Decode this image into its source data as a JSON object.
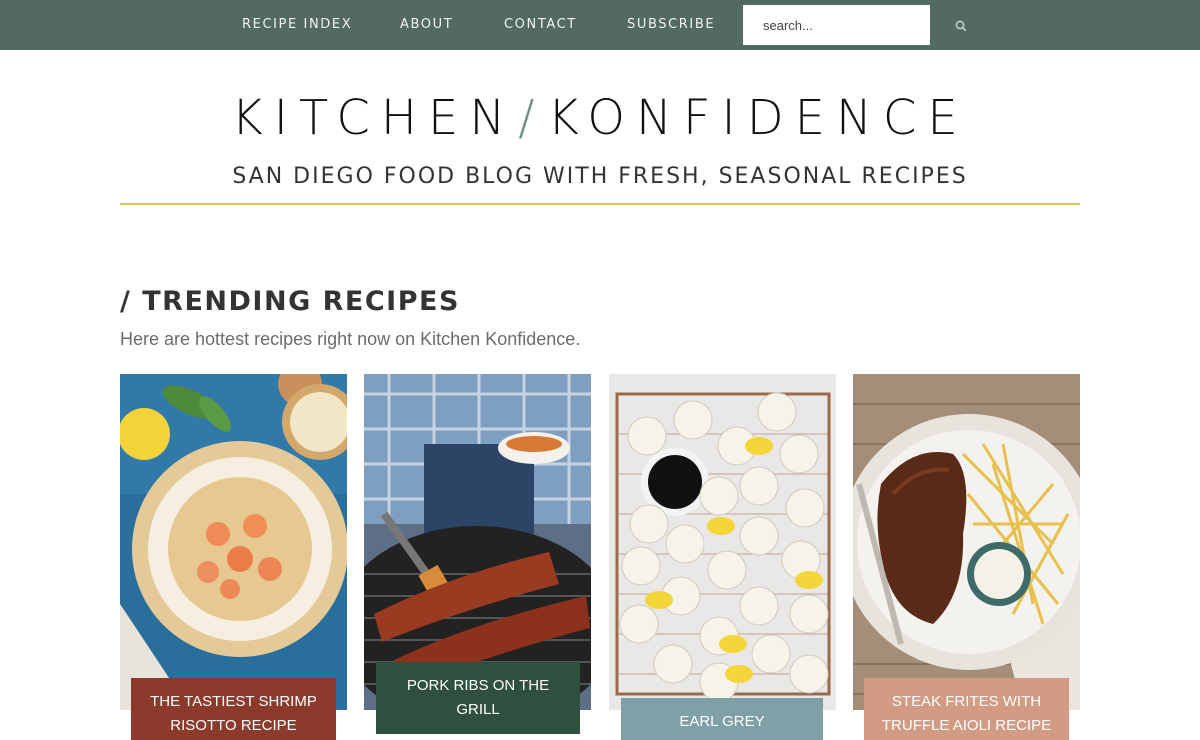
{
  "nav": {
    "items": [
      {
        "label": "RECIPE INDEX"
      },
      {
        "label": "ABOUT"
      },
      {
        "label": "CONTACT"
      },
      {
        "label": "SUBSCRIBE"
      }
    ],
    "search": {
      "placeholder": "search...",
      "icon": "search-icon"
    }
  },
  "header": {
    "title_left": "KITCHEN",
    "title_slash": "/",
    "title_right": "KONFIDENCE",
    "tagline": "SAN DIEGO FOOD BLOG WITH FRESH, SEASONAL RECIPES"
  },
  "section": {
    "title": "/ TRENDING RECIPES",
    "subtitle": "Here are hottest recipes right now on Kitchen Konfidence."
  },
  "cards": [
    {
      "label": "THE TASTIEST SHRIMP RISOTTO RECIPE",
      "color": "#8b3a2b"
    },
    {
      "label": "PORK RIBS ON THE GRILL",
      "color": "#2f4f3f"
    },
    {
      "label": "EARL GREY SHORTBREAD COOKIES WITH LEMON",
      "color": "#7fa0a6"
    },
    {
      "label": "STEAK FRITES WITH TRUFFLE AIOLI RECIPE",
      "color": "#d39a84"
    }
  ],
  "colors": {
    "nav_bg": "#526a5f",
    "accent_rule": "#d8c15c",
    "slash": "#6d8f7e"
  }
}
